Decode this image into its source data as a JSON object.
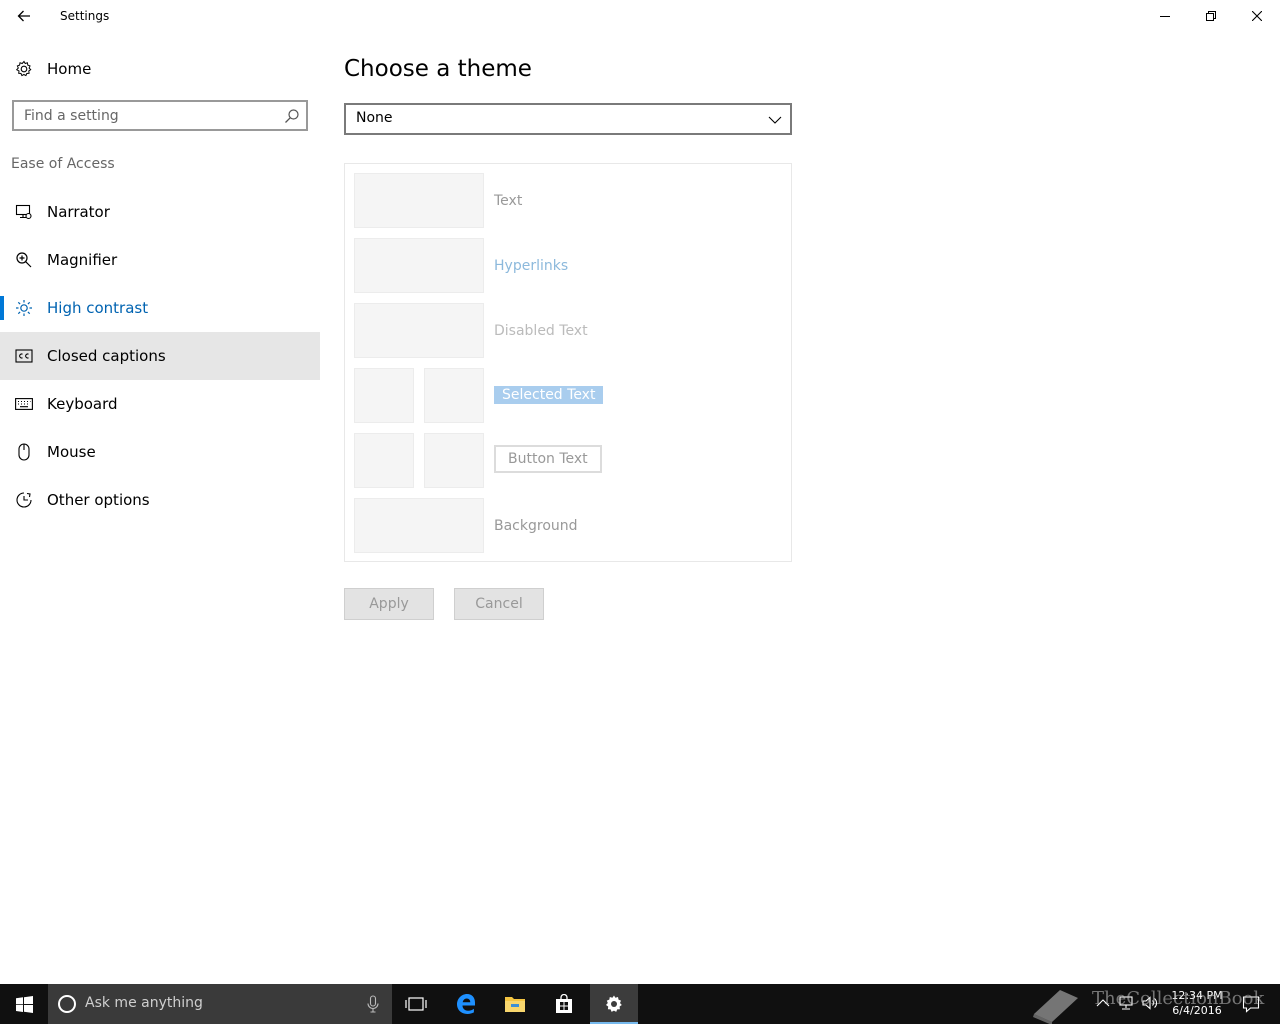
{
  "window": {
    "title": "Settings",
    "back_icon": "arrow-left-icon",
    "controls": [
      "minimize-icon",
      "restore-icon",
      "close-icon"
    ]
  },
  "sidebar": {
    "home_label": "Home",
    "search_placeholder": "Find a setting",
    "section_label": "Ease of Access",
    "items": [
      {
        "label": "Narrator",
        "icon": "narrator-icon"
      },
      {
        "label": "Magnifier",
        "icon": "magnifier-icon"
      },
      {
        "label": "High contrast",
        "icon": "brightness-icon",
        "active": true
      },
      {
        "label": "Closed captions",
        "icon": "cc-icon",
        "hover": true
      },
      {
        "label": "Keyboard",
        "icon": "keyboard-icon"
      },
      {
        "label": "Mouse",
        "icon": "mouse-icon"
      },
      {
        "label": "Other options",
        "icon": "other-options-icon"
      }
    ]
  },
  "main": {
    "title": "Choose a theme",
    "theme_select": {
      "value": "None"
    },
    "preview": {
      "text": "Text",
      "hyperlinks": "Hyperlinks",
      "disabled_text": "Disabled Text",
      "selected_text": "Selected Text",
      "button_text": "Button Text",
      "background": "Background"
    },
    "apply_label": "Apply",
    "cancel_label": "Cancel"
  },
  "taskbar": {
    "search_placeholder": "Ask me anything",
    "time": "12:34 PM",
    "date": "6/4/2016",
    "pinned": [
      "task-view-icon",
      "edge-icon",
      "file-explorer-icon",
      "store-icon",
      "settings-icon"
    ]
  },
  "watermark": "TheCollectionBook",
  "colors": {
    "accent": "#0078d7",
    "accent_text": "#0063b1",
    "hover_bg": "#e6e6e6",
    "taskbar_bg": "#101010",
    "selected_bg": "#a9cdee",
    "hyperlink": "#8cb9dc"
  }
}
